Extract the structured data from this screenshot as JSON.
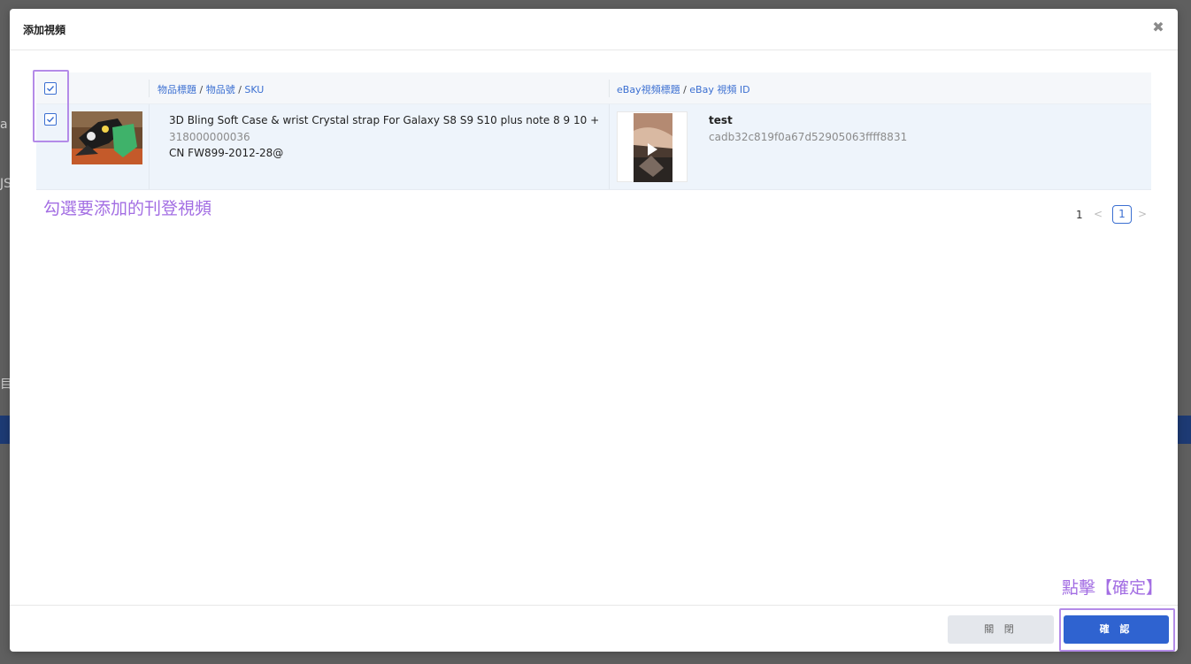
{
  "modal": {
    "title": "添加視頻",
    "close_icon": "close-icon"
  },
  "table": {
    "col_product": {
      "part1": "物品標題",
      "sep1": " / ",
      "part2": "物品號",
      "sep2": " / ",
      "part3": "SKU"
    },
    "col_video": {
      "part1": "eBay視頻標題",
      "sep": " / ",
      "part2": "eBay 視頻 ID"
    },
    "rows": [
      {
        "checked": true,
        "product_title": "3D Bling Soft Case & wrist Crystal strap For Galaxy S8 S9 S10 plus note 8 9 10 +",
        "item_no": "318000000036",
        "sku": "CN FW899-2012-28@",
        "video_title": "test",
        "video_id": "cadb32c819f0a67d52905063ffff8831"
      }
    ]
  },
  "annotations": {
    "select_hint": "勾選要添加的刊登視頻",
    "confirm_hint": "點擊【確定】"
  },
  "pagination": {
    "total": "1",
    "prev": "<",
    "current": "1",
    "next": ">"
  },
  "footer": {
    "close_label": "關 閉",
    "confirm_label": "確 認"
  },
  "colors": {
    "accent": "#2f63d0",
    "annotation": "#a36ee3",
    "row_selected": "#eef4fb"
  }
}
